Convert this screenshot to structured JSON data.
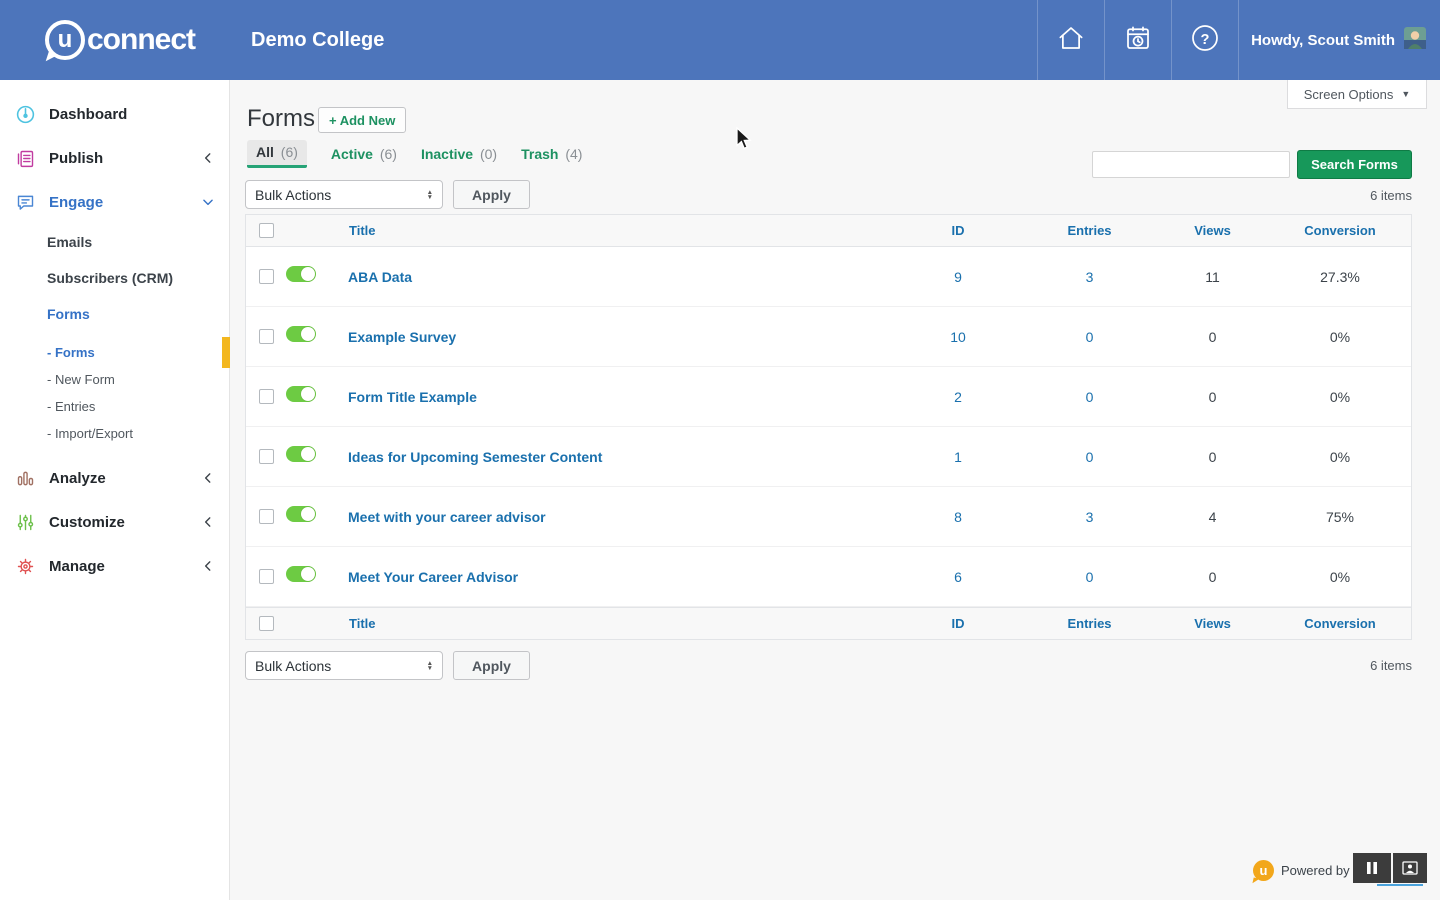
{
  "header": {
    "brand_bubble": "u",
    "brand_text": "connect",
    "site_name": "Demo College",
    "greeting": "Howdy, Scout Smith"
  },
  "screen_options": {
    "label": "Screen Options",
    "caret": "▼"
  },
  "sidebar": {
    "items": [
      {
        "label": "Dashboard"
      },
      {
        "label": "Publish"
      },
      {
        "label": "Engage"
      },
      {
        "label": "Emails"
      },
      {
        "label": "Subscribers (CRM)"
      },
      {
        "label": "Forms"
      },
      {
        "label": "- Forms"
      },
      {
        "label": "- New Form"
      },
      {
        "label": "- Entries"
      },
      {
        "label": "- Import/Export"
      },
      {
        "label": "Analyze"
      },
      {
        "label": "Customize"
      },
      {
        "label": "Manage"
      }
    ]
  },
  "page": {
    "title": "Forms",
    "add_new_label": "+ Add New",
    "tabs": [
      {
        "label": "All",
        "count": "(6)"
      },
      {
        "label": "Active",
        "count": "(6)"
      },
      {
        "label": "Inactive",
        "count": "(0)"
      },
      {
        "label": "Trash",
        "count": "(4)"
      }
    ],
    "bulk_actions_label": "Bulk Actions",
    "apply_label": "Apply",
    "search_placeholder": "",
    "search_button_label": "Search Forms",
    "items_count": "6 items"
  },
  "table": {
    "columns": {
      "title": "Title",
      "id": "ID",
      "entries": "Entries",
      "views": "Views",
      "conversion": "Conversion"
    },
    "rows": [
      {
        "title": "ABA Data",
        "id": "9",
        "entries": "3",
        "views": "11",
        "conversion": "27.3%",
        "enabled": true
      },
      {
        "title": "Example Survey",
        "id": "10",
        "entries": "0",
        "views": "0",
        "conversion": "0%",
        "enabled": true
      },
      {
        "title": "Form Title Example",
        "id": "2",
        "entries": "0",
        "views": "0",
        "conversion": "0%",
        "enabled": true
      },
      {
        "title": "Ideas for Upcoming Semester Content",
        "id": "1",
        "entries": "0",
        "views": "0",
        "conversion": "0%",
        "enabled": true
      },
      {
        "title": "Meet with your career advisor",
        "id": "8",
        "entries": "3",
        "views": "4",
        "conversion": "75%",
        "enabled": true
      },
      {
        "title": "Meet Your Career Advisor",
        "id": "6",
        "entries": "0",
        "views": "0",
        "conversion": "0%",
        "enabled": true
      }
    ]
  },
  "footer": {
    "powered_by": "Powered by",
    "logo_bubble": "u"
  },
  "colors": {
    "header_blue": "#4d75bb",
    "link_blue": "#1a70ad",
    "nav_active_blue": "#3572c6",
    "tab_green": "#1d9161",
    "button_green": "#17985a",
    "toggle_green": "#6dcb43",
    "accent_yellow": "#f3b71f",
    "logo_orange": "#f2a71b"
  }
}
